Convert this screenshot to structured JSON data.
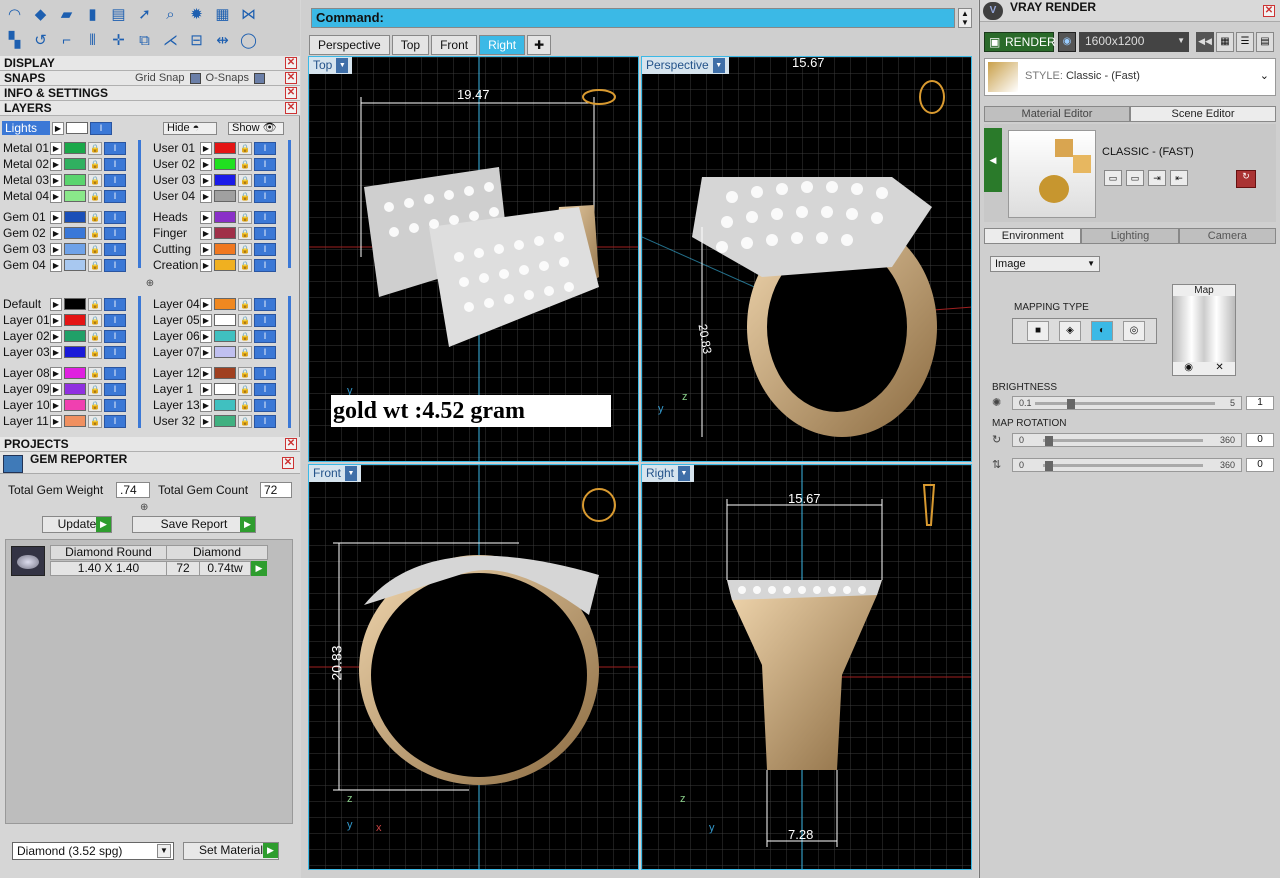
{
  "toolbar": {
    "row1_icons": [
      "curve-icon",
      "gem-icon",
      "surface-icon",
      "solid-icon",
      "page-icon",
      "transform-icon",
      "zoom-icon",
      "gear-icon",
      "render-icon",
      "snap-icon"
    ],
    "row2_icons": [
      "layers-icon",
      "arc-icon",
      "polyline-icon",
      "mirror-icon",
      "move-icon",
      "copy-icon",
      "split-icon",
      "boolean-icon",
      "measure-icon",
      "circle-icon"
    ]
  },
  "sections": {
    "display": "DISPLAY",
    "snaps": "SNAPS",
    "grid_snap": "Grid Snap",
    "o_snaps": "O-Snaps",
    "info": "INFO & SETTINGS",
    "layers": "LAYERS",
    "projects": "PROJECTS"
  },
  "layers_panel": {
    "lights": "Lights",
    "hide": "Hide",
    "show": "Show",
    "left_groups": [
      [
        {
          "name": "Metal 01",
          "color": "#1aa84a"
        },
        {
          "name": "Metal 02",
          "color": "#30b060"
        },
        {
          "name": "Metal 03",
          "color": "#5ad46e"
        },
        {
          "name": "Metal 04",
          "color": "#8ae88a"
        }
      ],
      [
        {
          "name": "Gem 01",
          "color": "#1a4fb8"
        },
        {
          "name": "Gem 02",
          "color": "#3a78d8"
        },
        {
          "name": "Gem 03",
          "color": "#6fa2e8"
        },
        {
          "name": "Gem 04",
          "color": "#a8c8f0"
        }
      ],
      [
        {
          "name": "Default",
          "color": "#000000"
        },
        {
          "name": "Layer 01",
          "color": "#e41414"
        },
        {
          "name": "Layer 02",
          "color": "#20a068"
        },
        {
          "name": "Layer 03",
          "color": "#1a1ad8"
        }
      ],
      [
        {
          "name": "Layer 08",
          "color": "#e020e0"
        },
        {
          "name": "Layer 09",
          "color": "#9030e0"
        },
        {
          "name": "Layer 10",
          "color": "#f040b0"
        },
        {
          "name": "Layer 11",
          "color": "#f09060"
        }
      ]
    ],
    "right_groups": [
      [
        {
          "name": "User 01",
          "color": "#e41414"
        },
        {
          "name": "User 02",
          "color": "#20e020"
        },
        {
          "name": "User 03",
          "color": "#1a1ae8"
        },
        {
          "name": "User 04",
          "color": "#a0a0a0"
        }
      ],
      [
        {
          "name": "Heads",
          "color": "#8a30c8"
        },
        {
          "name": "Finger",
          "color": "#a03048"
        },
        {
          "name": "Cutting",
          "color": "#f07820"
        },
        {
          "name": "Creation",
          "color": "#f0b020"
        }
      ],
      [
        {
          "name": "Layer 04",
          "color": "#f08820"
        },
        {
          "name": "Layer 05",
          "color": "#ffffff"
        },
        {
          "name": "Layer 06",
          "color": "#40c0c0"
        },
        {
          "name": "Layer 07",
          "color": "#c0c0f0"
        }
      ],
      [
        {
          "name": "Layer 12",
          "color": "#a04020"
        },
        {
          "name": "Layer 1",
          "color": "#ffffff"
        },
        {
          "name": "Layer 13",
          "color": "#40c0c0"
        },
        {
          "name": "User 32",
          "color": "#40b080"
        }
      ]
    ]
  },
  "gem_reporter": {
    "title": "GEM REPORTER",
    "total_weight_label": "Total Gem Weight",
    "total_weight_value": ".74",
    "total_count_label": "Total Gem Count",
    "total_count_value": "72",
    "update_label": "Update",
    "save_label": "Save Report",
    "gem_name": "Diamond Round",
    "gem_size": "1.40 X 1.40",
    "gem_material": "Diamond",
    "gem_count": "72",
    "gem_tw": "0.74tw",
    "material_select": "Diamond    (3.52 spg)",
    "set_material": "Set Material"
  },
  "command": {
    "label": "Command:"
  },
  "view_tabs": [
    "Perspective",
    "Top",
    "Front",
    "Right"
  ],
  "view_tab_active": "Right",
  "viewports": {
    "top": {
      "label": "Top",
      "dim": "19.47",
      "axis_y": "y"
    },
    "perspective": {
      "label": "Perspective",
      "dim_top": "15.67",
      "dim_side": "20.83",
      "axis_y": "y",
      "axis_z": "z"
    },
    "front": {
      "label": "Front",
      "dim": "20.83",
      "axis_z": "z",
      "axis_x": "x",
      "axis_y": "y"
    },
    "right": {
      "label": "Right",
      "dim_top": "15.67",
      "dim_bottom": "7.28",
      "axis_z": "z",
      "axis_y": "y"
    },
    "gold_weight": "gold wt :4.52 gram"
  },
  "vray": {
    "title": "VRAY RENDER",
    "render": "RENDER",
    "resolution": "1600x1200",
    "style_key": "STYLE:",
    "style_value": "Classic - (Fast)",
    "tabs": [
      "Material Editor",
      "Scene Editor"
    ],
    "tab_active": "Scene Editor",
    "scene_name": "CLASSIC - (FAST)",
    "env_tabs": [
      "Environment",
      "Lighting",
      "Camera"
    ],
    "env_active": "Environment",
    "image_select": "Image",
    "mapping_type": "MAPPING TYPE",
    "map_label": "Map",
    "brightness_label": "BRIGHTNESS",
    "brightness_min": "0.1",
    "brightness_max": "5",
    "brightness_value": "1",
    "map_rotation_label": "MAP ROTATION",
    "rot1_min": "0",
    "rot1_max": "360",
    "rot1_value": "0",
    "rot2_min": "0",
    "rot2_max": "360",
    "rot2_value": "0"
  }
}
